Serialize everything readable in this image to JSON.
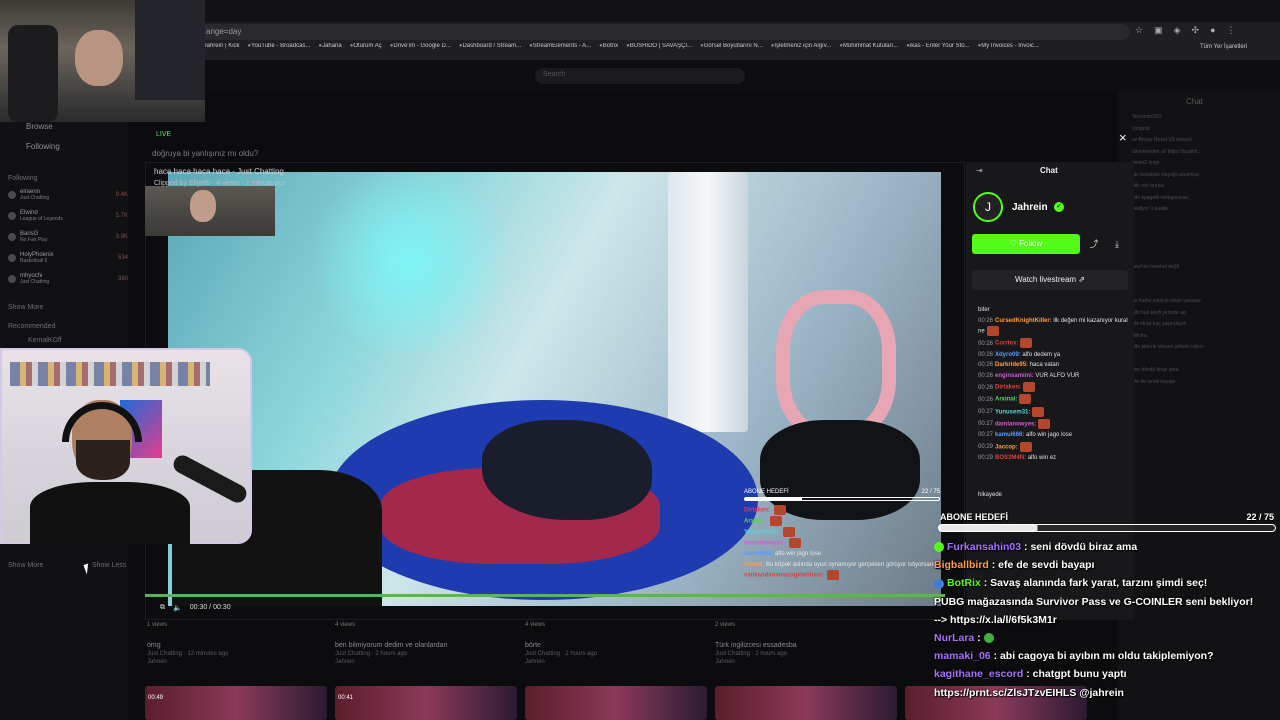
{
  "browser": {
    "url_fragment": "ange=day",
    "bookmarks": [
      "Jahrein | Kick",
      "YouTube - Broadcas...",
      "Jaharia",
      "Oturum Aç",
      "Drive'ım - Google D...",
      "Dashboard / Stream...",
      "StreamElements - A...",
      "Botrix",
      "BUSHIDO | SAVAŞÇI...",
      "Görsel Boyutlarını N...",
      "İşletmeniz için Algıv...",
      "Mühimmat Kutuları...",
      "ikas - Enter Your Sto...",
      "My Invoices - Invoic..."
    ],
    "all_bookmarks": "Tüm Yer İşaretleri"
  },
  "site": {
    "search_placeholder": "Search",
    "sidebar": {
      "browse": "Browse",
      "following": "Following",
      "following_head": "Following",
      "channels": [
        {
          "name": "elraenn",
          "game": "Just Chatting",
          "viewers": "9.4K"
        },
        {
          "name": "Elwind",
          "game": "League of Legends",
          "viewers": "5.7K"
        },
        {
          "name": "BarisG",
          "game": "No Fair Play",
          "viewers": "3.9K"
        },
        {
          "name": "HolyPhoenix",
          "game": "Basketball 6",
          "viewers": "534"
        },
        {
          "name": "mhyochi",
          "game": "Just Chatting",
          "viewers": "380"
        }
      ],
      "show_more": "Show More",
      "recommended_head": "Recommended",
      "rec_channel": "KemalKOff",
      "show_more_bottom": "Show More",
      "show_less": "Show Less"
    },
    "live_label": "LIVE",
    "bg_question": "doğruya bi yanlışınız mı oldu?",
    "right_chat_title": "Chat"
  },
  "clip": {
    "title": "haca haca haca haca - Just Chatting",
    "meta": "Clipped by Eliyeth · 4 views · 1 minute ago",
    "time": "00:30 / 00:30",
    "goal_label": "ABONE HEDEFİ",
    "goal_count": "22 / 75",
    "goal_fraction": 0.2933,
    "alerts": [
      {
        "user": "Dirtaken:",
        "text": "",
        "color": "#e04040"
      },
      {
        "user": "Arxinal:",
        "text": "",
        "color": "#59d659"
      },
      {
        "user": "Yunusem31:",
        "text": "",
        "color": "#59d6d6"
      },
      {
        "user": "damlanowyes:",
        "text": "",
        "color": "#d659d6"
      },
      {
        "user": "kamui666:",
        "text": "alfo win jago lose",
        "color": "#5c9bff"
      },
      {
        "user": "Nihat0:",
        "text": "Bu köpek aslında oyun oynamıyor gerçekleri görüyor istiyorsann...",
        "color": "#ff9d42"
      },
      {
        "user": "vatikandanamazagidenhaci:",
        "text": "",
        "color": "#e04040"
      }
    ]
  },
  "modal_chat": {
    "title": "Chat",
    "channel": "Jahrein",
    "follow_label": "♡ Follow",
    "watch_label": "Watch livestream ⇗",
    "messages": [
      {
        "time": "",
        "user": "",
        "text": "biter",
        "color": "#e0e0e4",
        "emote": false
      },
      {
        "time": "00:26",
        "user": "CursedKnightKiller:",
        "text": "ilk değen mi kazanıyor kural ne",
        "color": "#ff9d42",
        "emote": true
      },
      {
        "time": "00:26",
        "user": "Corrtex:",
        "text": "",
        "color": "#e04040",
        "emote": true
      },
      {
        "time": "00:26",
        "user": "Xdyro09:",
        "text": "alfo dedem ya",
        "color": "#5c9bff",
        "emote": false
      },
      {
        "time": "00:26",
        "user": "Darkride95:",
        "text": "haca vatan",
        "color": "#ff9d42",
        "emote": false
      },
      {
        "time": "00:26",
        "user": "enginsamimi:",
        "text": "VUR ALFO VUR",
        "color": "#d659d6",
        "emote": false
      },
      {
        "time": "00:26",
        "user": "Dirtaken:",
        "text": "",
        "color": "#e04040",
        "emote": true
      },
      {
        "time": "00:26",
        "user": "Arxinal:",
        "text": "",
        "color": "#59d659",
        "emote": true
      },
      {
        "time": "00:27",
        "user": "Yunusem31:",
        "text": "",
        "color": "#59d6d6",
        "emote": true
      },
      {
        "time": "00:27",
        "user": "damlanowyes:",
        "text": "",
        "color": "#d659d6",
        "emote": true
      },
      {
        "time": "00:27",
        "user": "kamui666:",
        "text": "alfo win jago lose",
        "color": "#5c9bff",
        "emote": false
      },
      {
        "time": "00:29",
        "user": "Jaccop:",
        "text": "",
        "color": "#ff9d42",
        "emote": true
      },
      {
        "time": "00:29",
        "user": "BOS3M4N:",
        "text": "alfo win ez",
        "color": "#e04040",
        "emote": false
      }
    ],
    "truncated_message": "hikayede"
  },
  "bottom_videos": [
    {
      "views": "1 views",
      "title": "omg",
      "sub": "Just Chatting · 12 minutes ago",
      "channel": "Jahrein"
    },
    {
      "views": "4 views",
      "title": "ben bilmiyorum dedim ve olanlardan",
      "sub": "Just Chatting · 2 hours ago",
      "channel": "Jahrein"
    },
    {
      "views": "4 views",
      "title": "börte",
      "sub": "Just Chatting · 2 hours ago",
      "channel": "Jahrein"
    },
    {
      "views": "2 views",
      "title": "Türk ingilizcesi essadesba",
      "sub": "Just Chatting · 2 hours ago",
      "channel": "Jahrein"
    }
  ],
  "bottom_durations": [
    "00:49",
    "00:41",
    "",
    "",
    ""
  ],
  "overlay_chat": {
    "goal_label": "ABONE HEDEFİ",
    "goal_count": "22 / 75",
    "goal_fraction": 0.2933,
    "lines": [
      {
        "user": "Furkansahin03",
        "text": " : seni dövdü biraz ama",
        "color": "#a970ff",
        "badge": "#53fc18"
      },
      {
        "user": "Bigballbird",
        "text": " : efe de sevdi bayapı",
        "color": "#ff9d42",
        "badge": ""
      },
      {
        "user": "BotRix",
        "text": " : Savaş alanında fark yarat, tarzını şimdi seç!",
        "color": "#53fc18",
        "badge": "#3b7dd8"
      },
      {
        "user": "",
        "text": "PUBG mağazasında Survivor Pass ve G-COINLER seni bekliyor!",
        "color": "#ffffff",
        "badge": ""
      },
      {
        "user": "",
        "text": "--> https://x.la/l/6f5k3M1r",
        "color": "#ffffff",
        "badge": ""
      },
      {
        "user": "NurLara",
        "text": " : ",
        "color": "#a970ff",
        "badge": "",
        "emote": true
      },
      {
        "user": "mamaki_06",
        "text": " : abi cagoya bi ayıbın mı oldu takiplemiyon?",
        "color": "#a970ff",
        "badge": ""
      },
      {
        "user": "kagithane_escord",
        "text": " : chatgpt bunu yaptı",
        "color": "#a970ff",
        "badge": ""
      },
      {
        "user": "",
        "text": "https://prnt.sc/ZlsJTzvEIHLS @jahrein",
        "color": "#ffffff",
        "badge": ""
      }
    ]
  },
  "right_panel_lines": [
    "Tenvimm32O",
    "Jongold",
    "ve Beyaz Rozet V3 satışta!",
    "tükenmeden al! https://bushid...",
    "metin2 ringe",
    "abi temakları bayağı uzunmuş",
    "alfo win burkai",
    "alfo spagetti vizitapsunan",
    "bekliyor 1 saatle",
    "",
    "",
    "",
    "",
    "neyi'nin hareket değil",
    "",
    "",
    "gu kadar yıkayıp olsun yavaşta",
    "alfo'nun keyfi yerinde aq",
    "abi efrad kaç yaşındaydı",
    "dilinihu",
    "alfo jahrein izleyen jahrein izliyor",
    "",
    "sen dövdü biraz ama",
    "efe de sevdi bayapı",
    "",
    "",
    "",
    "",
    ""
  ]
}
